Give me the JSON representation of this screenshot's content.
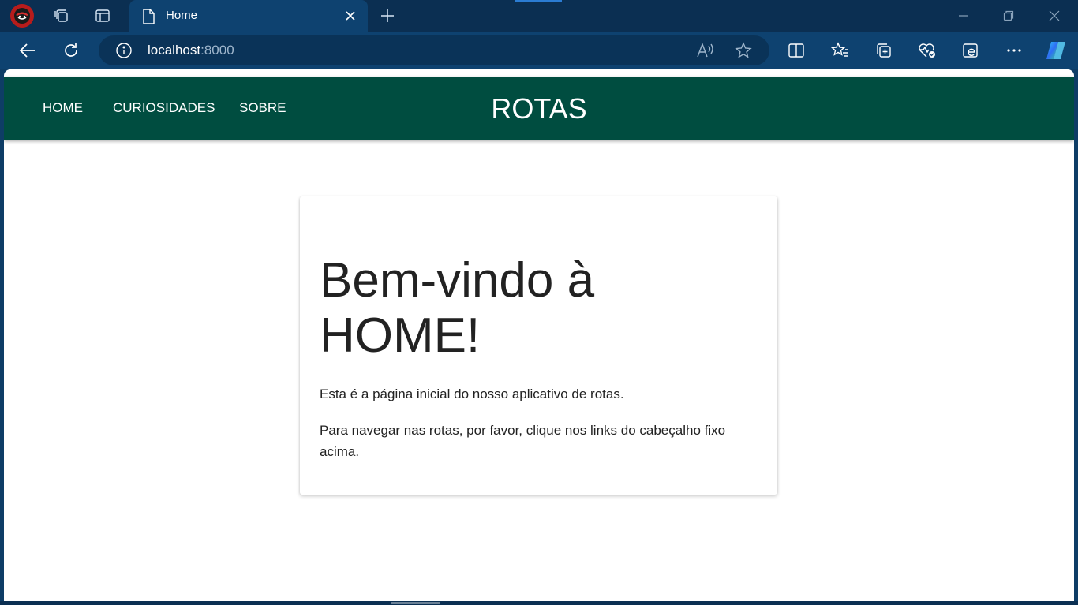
{
  "browser": {
    "tab": {
      "title": "Home"
    },
    "address": {
      "host": "localhost",
      "port": ":8000"
    }
  },
  "site": {
    "nav": [
      {
        "label": "HOME"
      },
      {
        "label": "CURIOSIDADES"
      },
      {
        "label": "SOBRE"
      }
    ],
    "brand": "ROTAS"
  },
  "main": {
    "heading": "Bem-vindo à HOME!",
    "paragraphs": [
      "Esta é a página inicial do nosso aplicativo de rotas.",
      "Para navegar nas rotas, por favor, clique nos links do cabeçalho fixo acima."
    ]
  },
  "colors": {
    "header_bg": "#004d40",
    "browser_frame": "#0e4270",
    "text": "#222222"
  },
  "icons": [
    "profile-avatar-icon",
    "workspaces-icon",
    "tab-actions-icon",
    "document-icon",
    "close-icon",
    "new-tab-icon",
    "minimize-icon",
    "restore-icon",
    "window-close-icon",
    "back-icon",
    "refresh-icon",
    "info-icon",
    "read-aloud-icon",
    "favorite-star-icon",
    "split-screen-icon",
    "favorites-icon",
    "collections-icon",
    "browser-essentials-icon",
    "ie-mode-icon",
    "more-icon",
    "copilot-icon"
  ]
}
